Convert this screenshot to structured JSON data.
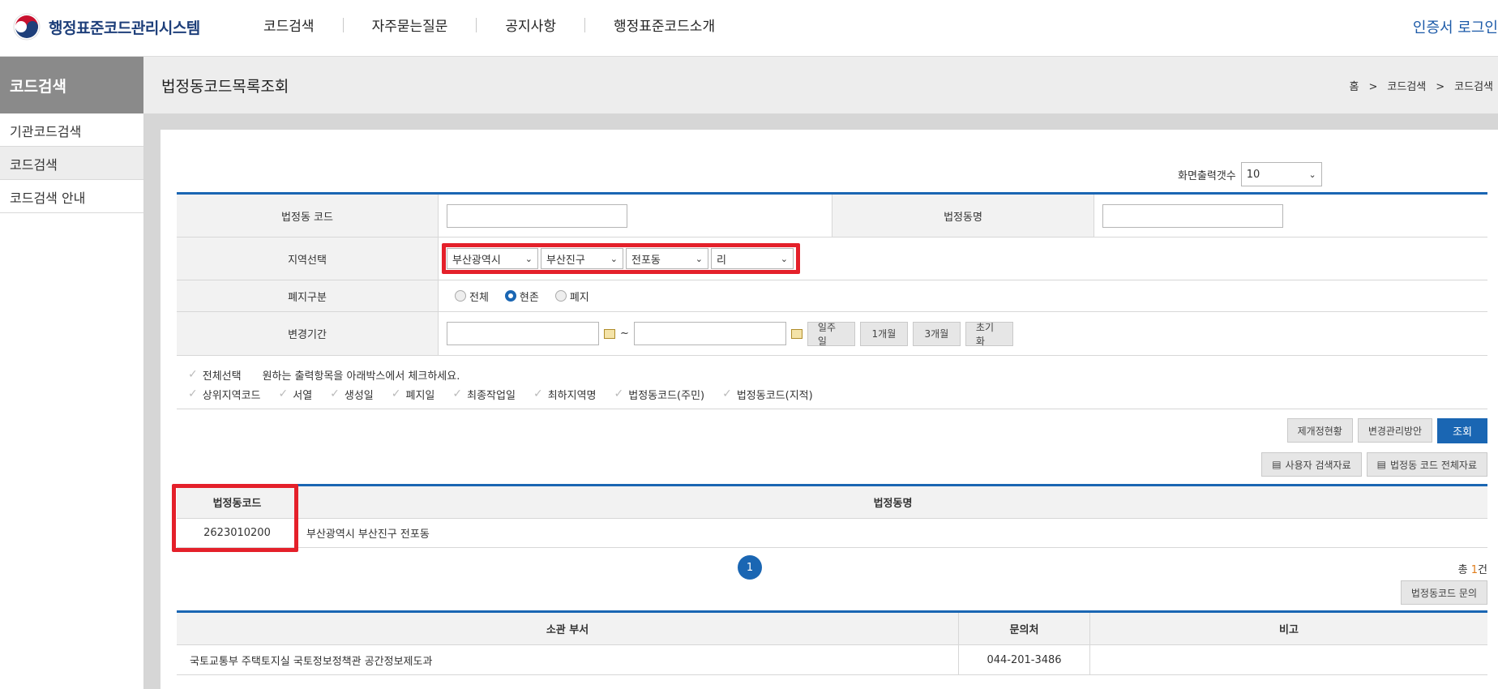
{
  "header": {
    "logo_text": "행정표준코드관리시스템",
    "nav": [
      "코드검색",
      "자주묻는질문",
      "공지사항",
      "행정표준코드소개"
    ],
    "login": "인증서 로그인"
  },
  "sidebar": {
    "title": "코드검색",
    "items": [
      "기관코드검색",
      "코드검색",
      "코드검색 안내"
    ]
  },
  "page": {
    "title": "법정동코드목록조회",
    "breadcrumb": [
      "홈",
      "코드검색",
      "코드검색"
    ],
    "breadcrumb_sep": ">"
  },
  "perpage": {
    "label": "화면출력갯수",
    "value": "10"
  },
  "search": {
    "code_label": "법정동 코드",
    "code_value": "",
    "name_label": "법정동명",
    "name_value": "",
    "region_label": "지역선택",
    "region_selects": [
      "부산광역시",
      "부산진구",
      "전포동",
      "리"
    ],
    "abolish_label": "폐지구분",
    "abolish_options": [
      "전체",
      "현존",
      "폐지"
    ],
    "abolish_selected": "현존",
    "period_label": "변경기간",
    "period_from": "",
    "period_to": "",
    "tilde": "~",
    "period_buttons": [
      "일주일",
      "1개월",
      "3개월",
      "초기화"
    ]
  },
  "checklist": {
    "select_all": "전체선택",
    "hint": "원하는 출력항목을 아래박스에서 체크하세요.",
    "items": [
      "상위지역코드",
      "서열",
      "생성일",
      "폐지일",
      "최종작업일",
      "최하지역명",
      "법정동코드(주민)",
      "법정동코드(지적)"
    ]
  },
  "buttons": {
    "revision": "제개정현황",
    "manage": "변경관리방안",
    "search": "조회",
    "user_data": "사용자 검색자료",
    "all_data": "법정동 코드 전체자료",
    "inquiry": "법정동코드 문의"
  },
  "results": {
    "headers": [
      "법정동코드",
      "법정동명"
    ],
    "rows": [
      {
        "code": "2623010200",
        "name": "부산광역시 부산진구 전포동"
      }
    ]
  },
  "pagination": {
    "current": "1"
  },
  "total": {
    "prefix": "총 ",
    "count": "1",
    "suffix": "건"
  },
  "dept": {
    "headers": [
      "소관 부서",
      "문의처",
      "비고"
    ],
    "rows": [
      {
        "dept": "국토교통부 주택토지실 국토정보정책관 공간정보제도과",
        "contact": "044-201-3486",
        "note": ""
      }
    ]
  },
  "colors": {
    "accent": "#1a66b3",
    "highlight": "#e4202a",
    "sidebar_title_bg": "#8a8a8a"
  }
}
